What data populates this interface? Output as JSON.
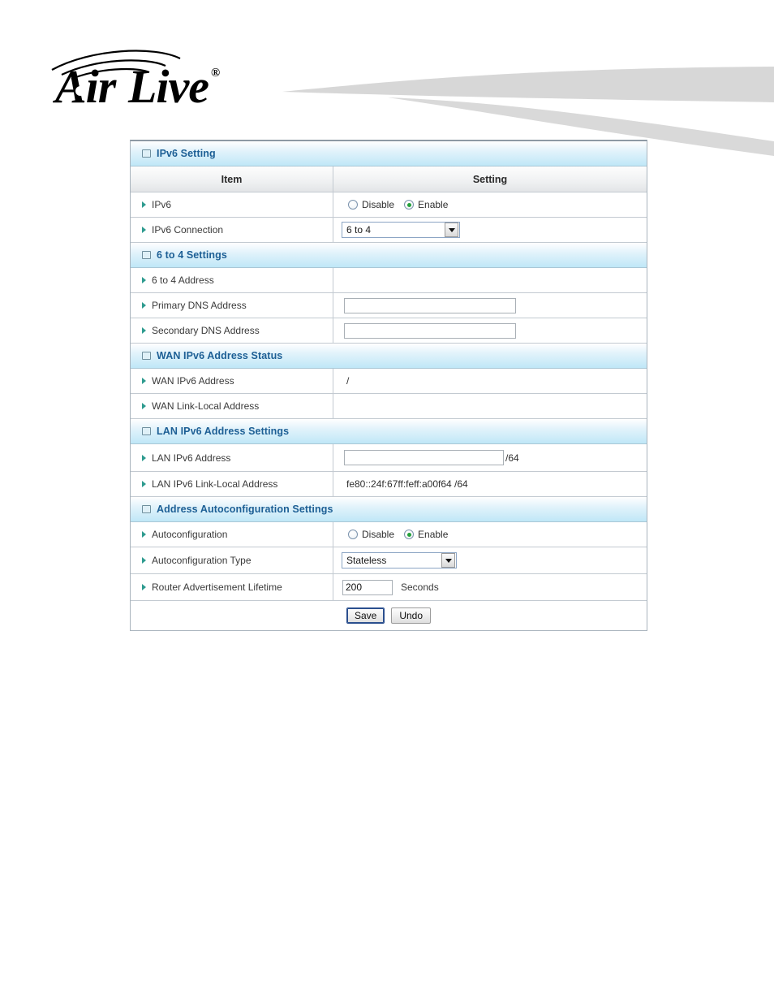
{
  "brand": {
    "name": "Air Live",
    "trademark": "®",
    "logo_icon": "wifi-waves-icon"
  },
  "panel": {
    "column_headers": {
      "item": "Item",
      "setting": "Setting"
    },
    "sections": [
      {
        "id": "ipv6-setting",
        "title": "IPv6 Setting",
        "rows": [
          {
            "id": "ipv6",
            "label": "IPv6",
            "control": "radio",
            "options": [
              "Disable",
              "Enable"
            ],
            "selected": "Enable"
          },
          {
            "id": "ipv6-connection",
            "label": "IPv6 Connection",
            "control": "select",
            "value": "6 to 4"
          }
        ]
      },
      {
        "id": "6to4-settings",
        "title": "6 to 4 Settings",
        "rows": [
          {
            "id": "6to4-address",
            "label": "6 to 4 Address",
            "control": "empty",
            "value": ""
          },
          {
            "id": "primary-dns-address",
            "label": "Primary DNS Address",
            "control": "text",
            "value": "",
            "placeholder": ""
          },
          {
            "id": "secondary-dns-address",
            "label": "Secondary DNS Address",
            "control": "text",
            "value": "",
            "placeholder": ""
          }
        ]
      },
      {
        "id": "wan-ipv6-address-status",
        "title": "WAN IPv6 Address Status",
        "rows": [
          {
            "id": "wan-ipv6-address",
            "label": "WAN IPv6 Address",
            "control": "static",
            "value": "/"
          },
          {
            "id": "wan-link-local-address",
            "label": "WAN Link-Local Address",
            "control": "static",
            "value": ""
          }
        ]
      },
      {
        "id": "lan-ipv6-address-settings",
        "title": "LAN IPv6 Address Settings",
        "rows": [
          {
            "id": "lan-ipv6-address",
            "label": "LAN IPv6 Address",
            "control": "text-suffix",
            "value": "",
            "placeholder": "",
            "suffix": "/64"
          },
          {
            "id": "lan-ipv6-link-local-address",
            "label": "LAN IPv6 Link-Local Address",
            "control": "static",
            "value": "fe80::24f:67ff:feff:a00f64 /64"
          }
        ]
      },
      {
        "id": "address-autoconfiguration-settings",
        "title": "Address Autoconfiguration Settings",
        "rows": [
          {
            "id": "autoconfiguration",
            "label": "Autoconfiguration",
            "control": "radio",
            "options": [
              "Disable",
              "Enable"
            ],
            "selected": "Enable"
          },
          {
            "id": "autoconfiguration-type",
            "label": "Autoconfiguration Type",
            "control": "select",
            "value": "Stateless"
          },
          {
            "id": "router-advertisement-lifetime",
            "label": "Router Advertisement Lifetime",
            "control": "text-unit",
            "value": "200",
            "unit": "Seconds"
          }
        ]
      }
    ],
    "buttons": {
      "save": "Save",
      "undo": "Undo"
    }
  },
  "colors": {
    "section_title": "#1d5f95",
    "bullet": "#2e9b8f",
    "radio_selected": "#23a13a",
    "swoosh": "#d7d7d7",
    "panel_border": "#a9b4bd"
  }
}
